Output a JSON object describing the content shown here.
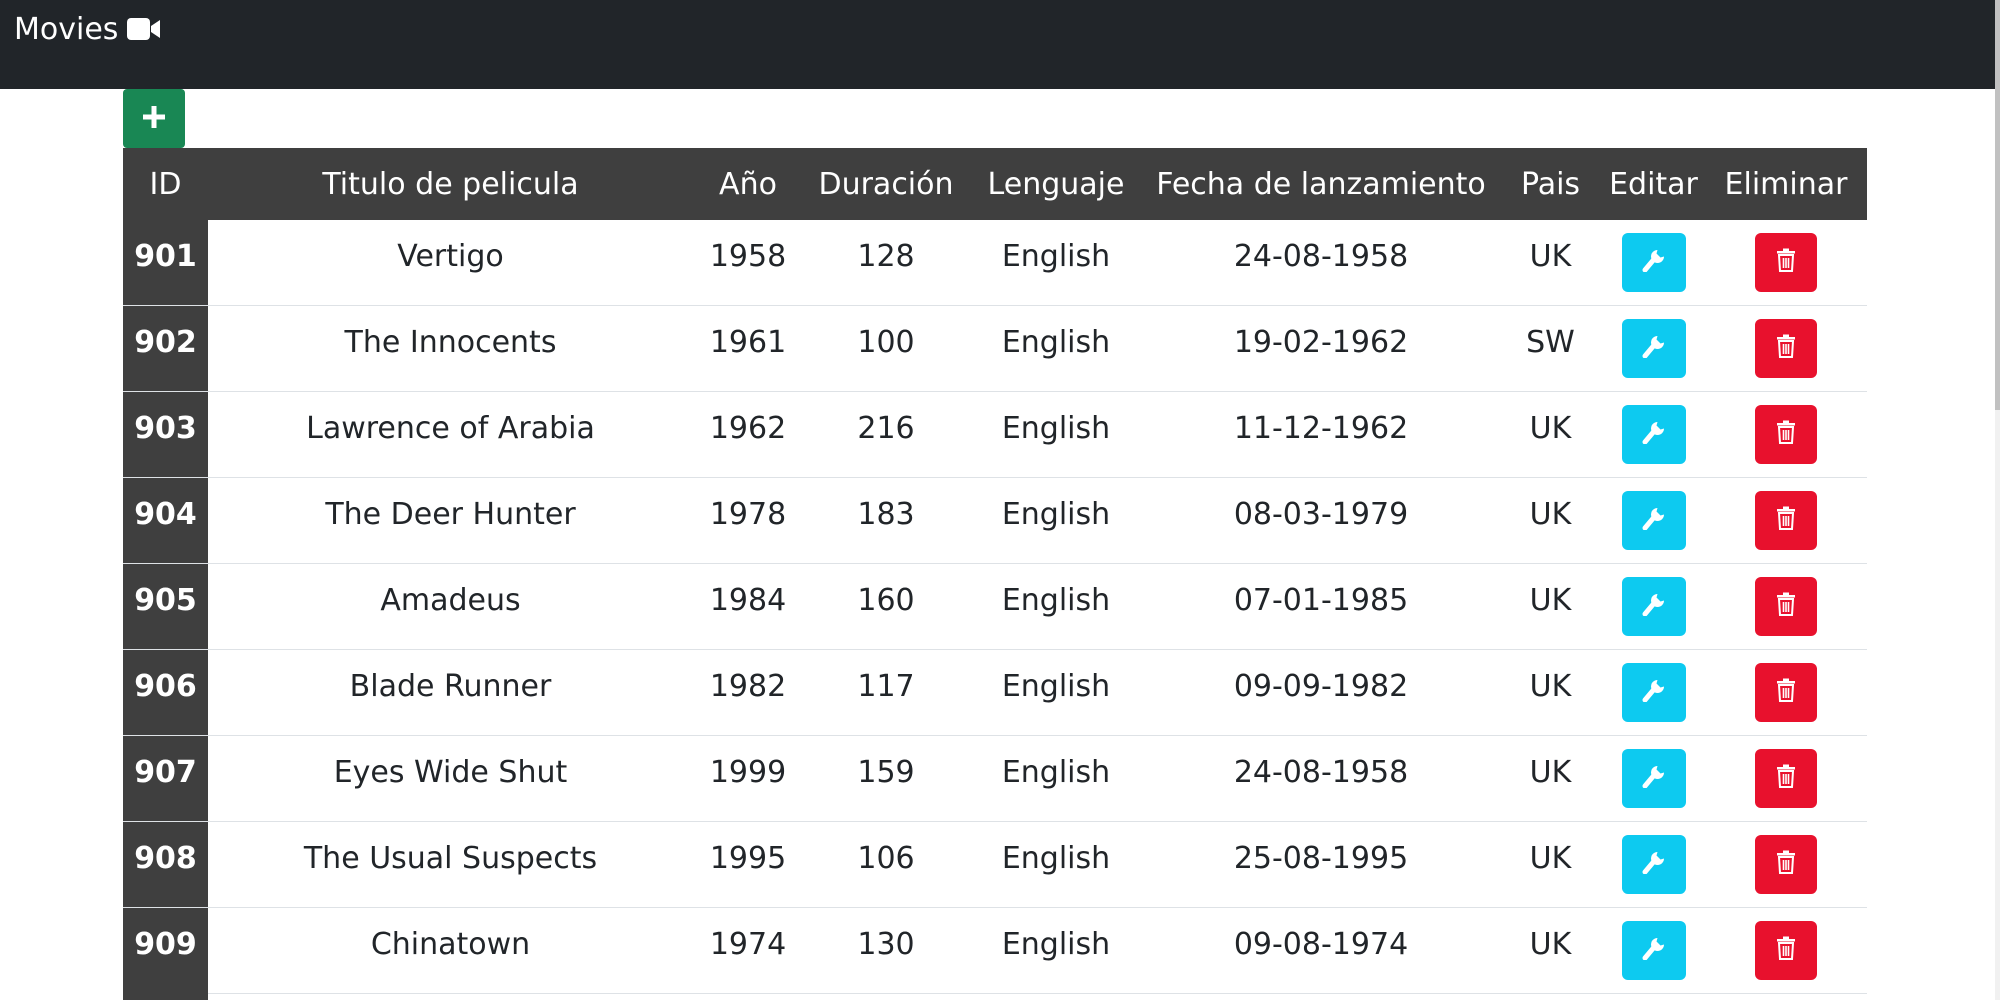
{
  "navbar": {
    "brand": "Movies",
    "brand_icon": "video-camera-icon",
    "background": "#212529"
  },
  "toolbar": {
    "add_icon": "plus-icon",
    "add_color": "#198754"
  },
  "table": {
    "headers": {
      "id": "ID",
      "title": "Titulo de pelicula",
      "year": "Año",
      "duration": "Duración",
      "language": "Lenguaje",
      "release_date": "Fecha de lanzamiento",
      "country": "Pais",
      "edit": "Editar",
      "delete": "Eliminar"
    },
    "rows": [
      {
        "id": "901",
        "title": "Vertigo",
        "year": "1958",
        "duration": "128",
        "language": "English",
        "release_date": "24-08-1958",
        "country": "UK"
      },
      {
        "id": "902",
        "title": "The Innocents",
        "year": "1961",
        "duration": "100",
        "language": "English",
        "release_date": "19-02-1962",
        "country": "SW"
      },
      {
        "id": "903",
        "title": "Lawrence of Arabia",
        "year": "1962",
        "duration": "216",
        "language": "English",
        "release_date": "11-12-1962",
        "country": "UK"
      },
      {
        "id": "904",
        "title": "The Deer Hunter",
        "year": "1978",
        "duration": "183",
        "language": "English",
        "release_date": "08-03-1979",
        "country": "UK"
      },
      {
        "id": "905",
        "title": "Amadeus",
        "year": "1984",
        "duration": "160",
        "language": "English",
        "release_date": "07-01-1985",
        "country": "UK"
      },
      {
        "id": "906",
        "title": "Blade Runner",
        "year": "1982",
        "duration": "117",
        "language": "English",
        "release_date": "09-09-1982",
        "country": "UK"
      },
      {
        "id": "907",
        "title": "Eyes Wide Shut",
        "year": "1999",
        "duration": "159",
        "language": "English",
        "release_date": "24-08-1958",
        "country": "UK"
      },
      {
        "id": "908",
        "title": "The Usual Suspects",
        "year": "1995",
        "duration": "106",
        "language": "English",
        "release_date": "25-08-1995",
        "country": "UK"
      },
      {
        "id": "909",
        "title": "Chinatown",
        "year": "1974",
        "duration": "130",
        "language": "English",
        "release_date": "09-08-1974",
        "country": "UK"
      }
    ],
    "edit_icon": "wrench-icon",
    "delete_icon": "trash-icon",
    "edit_color": "#0dcaf0",
    "delete_color": "#e8112d",
    "header_background": "#3f3f3f"
  }
}
